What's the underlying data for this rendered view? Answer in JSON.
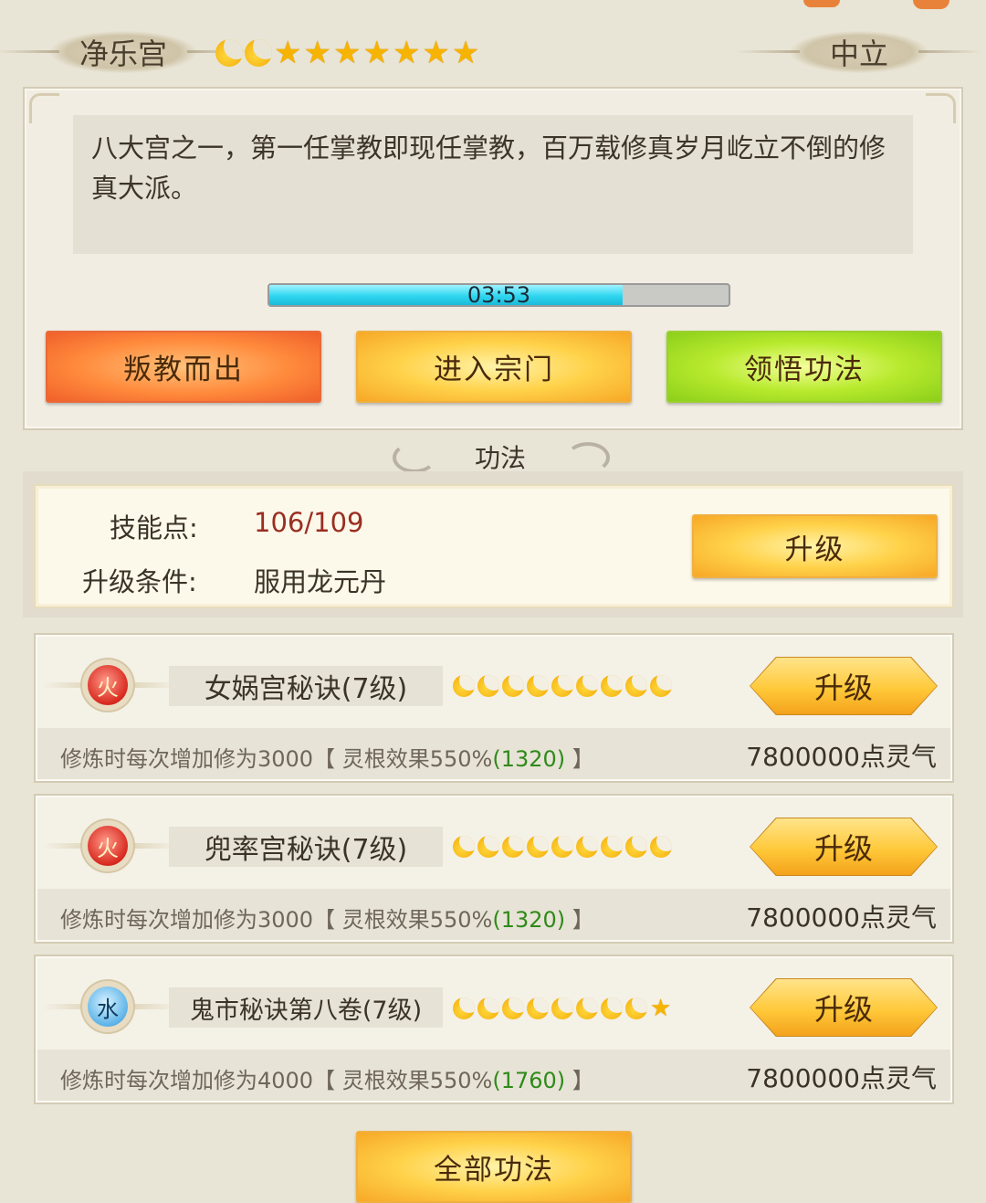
{
  "sect": {
    "name": "净乐宫",
    "alignment": "中立",
    "rank_moons": 2,
    "rank_stars": 7,
    "description": "八大宫之一，第一任掌教即现任掌教，百万载修真岁月屹立不倒的修真大派。",
    "timer": "03:53",
    "timer_progress": 0.77
  },
  "actions": {
    "defect_label": "叛教而出",
    "enter_label": "进入宗门",
    "comprehend_label": "领悟功法"
  },
  "skills_section": {
    "title": "功法",
    "skill_points_label": "技能点:",
    "skill_points_value": "106/109",
    "upgrade_condition_label": "升级条件:",
    "upgrade_condition_value": "服用龙元丹",
    "upgrade_label": "升级"
  },
  "techniques": [
    {
      "element": "火",
      "element_type": "fire",
      "name": "女娲宫秘诀(7级)",
      "moons": 9,
      "stars": 0,
      "upgrade_label": "升级",
      "effect_prefix": "修炼时每次增加修为3000【 灵根效果550%",
      "effect_value": "(1320)",
      "effect_suffix": " 】",
      "cost": "7800000点灵气"
    },
    {
      "element": "火",
      "element_type": "fire",
      "name": "兜率宫秘诀(7级)",
      "moons": 9,
      "stars": 0,
      "upgrade_label": "升级",
      "effect_prefix": "修炼时每次增加修为3000【 灵根效果550%",
      "effect_value": "(1320)",
      "effect_suffix": " 】",
      "cost": "7800000点灵气"
    },
    {
      "element": "水",
      "element_type": "water",
      "name": "鬼市秘诀第八卷(7级)",
      "moons": 8,
      "stars": 1,
      "upgrade_label": "升级",
      "effect_prefix": "修炼时每次增加修为4000【 灵根效果550%",
      "effect_value": "(1760)",
      "effect_suffix": " 】",
      "cost": "7800000点灵气"
    }
  ],
  "footer": {
    "all_skills_label": "全部功法"
  },
  "colors": {
    "accent_red": "#9a2e22",
    "effect_green": "#2f8a1a",
    "timer_fill": "#2ed6f0"
  }
}
